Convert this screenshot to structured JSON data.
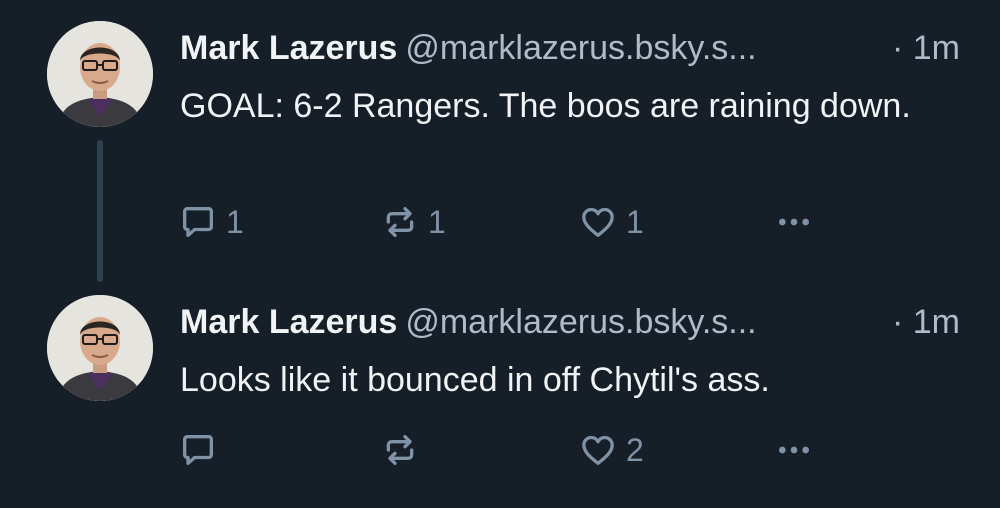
{
  "posts": [
    {
      "author_name": "Mark Lazerus",
      "handle": "@marklazerus.bsky.s...",
      "time": "· 1m",
      "text": "GOAL: 6-2 Rangers. The boos are raining down.",
      "reply_count": "1",
      "repost_count": "1",
      "like_count": "1"
    },
    {
      "author_name": "Mark Lazerus",
      "handle": "@marklazerus.bsky.s...",
      "time": "· 1m",
      "text": "Looks like it bounced in off Chytil's ass.",
      "reply_count": "",
      "repost_count": "",
      "like_count": "2"
    }
  ],
  "colors": {
    "background": "#161e27",
    "text": "#f1f3f5",
    "muted": "#aebbc9",
    "icon": "#7f92a6",
    "thread_line": "#2e4052"
  },
  "icons": {
    "reply": "speech-bubble-icon",
    "repost": "repost-arrows-icon",
    "like": "heart-icon",
    "more": "ellipsis-icon"
  }
}
